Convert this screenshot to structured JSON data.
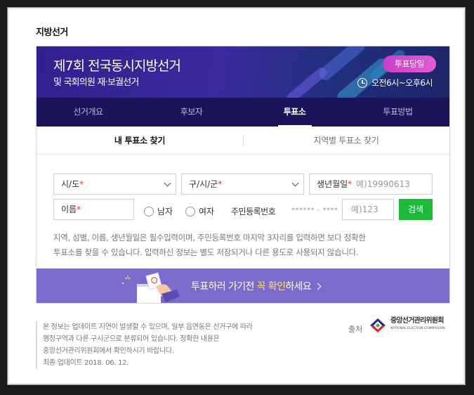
{
  "section": {
    "title": "지방선거"
  },
  "banner": {
    "title": "제7회 전국동시지방선거",
    "subtitle": "및 국회의원 재·보궐선거",
    "badge": "투표당일",
    "hours": "오전6시~오후6시"
  },
  "tabs": [
    "선거개요",
    "후보자",
    "투표소",
    "투표방법"
  ],
  "subtabs": [
    "내 투표소 찾기",
    "지역별 투표소 찾기"
  ],
  "form": {
    "sido_label": "시/도",
    "gu_label": "구/시/군",
    "birth_label": "생년월일",
    "birth_placeholder": "예)19990613",
    "name_label": "이름",
    "gender_male": "남자",
    "gender_female": "여자",
    "rrn_label": "주민등록번호",
    "rrn_mask": "****** - ****",
    "rrn_placeholder": "예)123",
    "search_button": "검색",
    "required_mark": "*"
  },
  "notice": {
    "line1": "지역, 성별, 이름, 생년월일은 필수입력이며, 주민등록번호 마지막 3자리를 입력하면 보다 정확한",
    "line2": "투표소를 찾을 수 있습니다. 입력하신 정보는 별도 저장되거나 다른 용도로 사용되지 않습니다."
  },
  "cta": {
    "before": "투표하러 가기전 ",
    "highlight": "꼭 확인",
    "after": "하세요"
  },
  "footnote": {
    "line1": "본 정보는 업데이트 지연이 발생할 수 있으며, 일부 읍면동은 선거구에 따라",
    "line2": "행정구역과 다른 구시군으로 분류되어 있습니다. 정확한 내용은",
    "line3": "중앙선거관리위원회에서 확인하시기 바랍니다.",
    "line4": "최종 업데이트 2018. 06. 12."
  },
  "source": {
    "label": "출처",
    "org_name": "중앙선거관리위원회",
    "org_name_en": "NATIONAL ELECTION COMMISSION"
  },
  "colors": {
    "banner": "#33208f",
    "tabbar": "#1a155a",
    "badge": "#d64ad0",
    "search": "#1db93a",
    "cta": "#7c6acd",
    "highlight": "#ffe066"
  },
  "icons": {
    "clock": "clock-icon",
    "chevron": "chevron-down-icon",
    "arrow": "chevron-right-icon"
  }
}
